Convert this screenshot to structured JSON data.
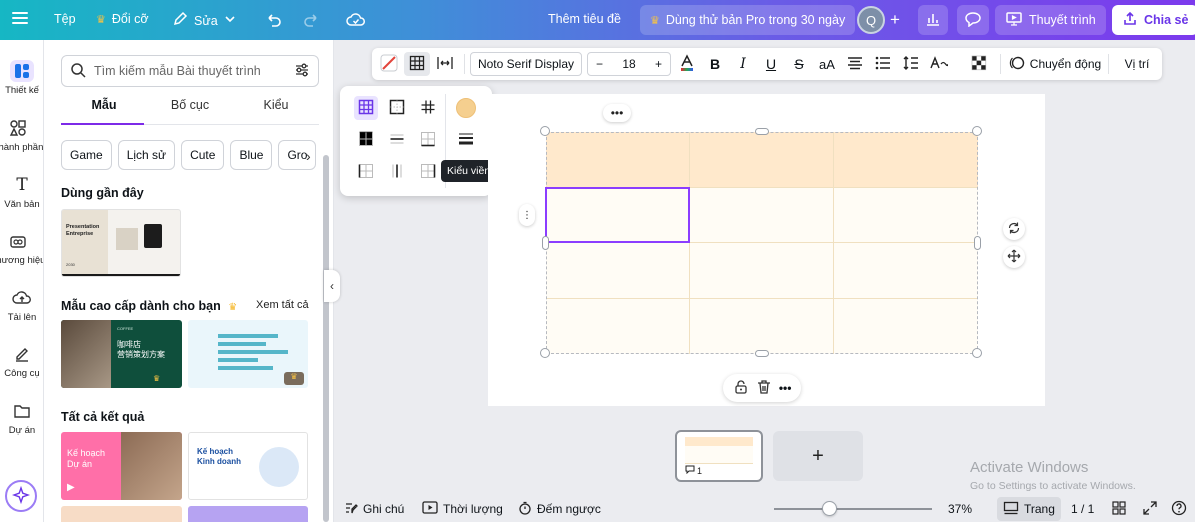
{
  "topbar": {
    "file": "Tệp",
    "resize": "Đổi cỡ",
    "edit": "Sửa",
    "doc_title": "Thêm tiêu đề",
    "pro_trial": "Dùng thử bản Pro trong 30 ngày",
    "avatar_initial": "Q",
    "present": "Thuyết trình",
    "share": "Chia sẻ"
  },
  "rail": {
    "items": [
      {
        "label": "Thiết kế"
      },
      {
        "label": "Thành phần"
      },
      {
        "label": "Văn bản"
      },
      {
        "label": "Thương hiệu"
      },
      {
        "label": "Tải lên"
      },
      {
        "label": "Công cụ"
      },
      {
        "label": "Dự án"
      }
    ]
  },
  "panel": {
    "search_placeholder": "Tìm kiếm mẫu Bài thuyết trình",
    "tabs": [
      "Mẫu",
      "Bố cục",
      "Kiểu"
    ],
    "chips": [
      "Game",
      "Lịch sử",
      "Cute",
      "Blue",
      "Gro"
    ],
    "recent_title": "Dùng gần đây",
    "recent_thumb": {
      "title": "Presentation Entreprise",
      "year": "2030"
    },
    "premium_title": "Mẫu cao cấp dành cho bạn",
    "see_all": "Xem tất cả",
    "premium_thumb1": {
      "title": "咖啡店\n营销策划方案",
      "brand": "COFFEE"
    },
    "all_results_title": "Tất cả kết quả",
    "result_thumb1": "Kế hoạch Dự án",
    "result_thumb2": "Kế hoạch Kinh doanh"
  },
  "toolbar": {
    "font": "Noto Serif Display",
    "size": "18",
    "minus": "−",
    "plus": "+",
    "bold": "B",
    "italic": "I",
    "underline": "U",
    "strike": "S",
    "case": "aA",
    "animate": "Chuyển động",
    "position": "Vị trí"
  },
  "popup": {
    "tooltip": "Kiểu viền",
    "swatch_color": "#f5cf8f"
  },
  "table": {
    "rows": 4,
    "cols": 3,
    "header_color": "#ffe9cc",
    "selected_cell": "row 2, col 1"
  },
  "pages": {
    "thumb_comment_count": "1"
  },
  "watermark": {
    "line1": "Activate Windows",
    "line2": "Go to Settings to activate Windows."
  },
  "bottombar": {
    "notes": "Ghi chú",
    "duration": "Thời lượng",
    "timer": "Đếm ngược",
    "zoom": "37%",
    "zoom_fraction": 0.37,
    "page_view": "Trang",
    "page_count": "1 / 1"
  },
  "colors": {
    "brand_purple": "#7d2ae8",
    "selection": "#8b3dff"
  }
}
